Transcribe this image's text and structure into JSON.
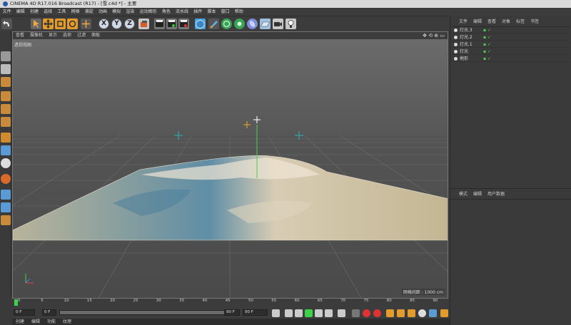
{
  "window": {
    "title": "CINEMA 4D R17.016 Broadcast (R17) - [雪.c4d *] - 主要"
  },
  "menu": [
    "文件",
    "编辑",
    "创建",
    "选择",
    "工具",
    "网格",
    "捕捉",
    "动画",
    "模拟",
    "渲染",
    "运动图形",
    "角色",
    "流水线",
    "插件",
    "脚本",
    "窗口",
    "帮助"
  ],
  "toolbar": {
    "axis_x": "X",
    "axis_y": "Y",
    "axis_z": "Z"
  },
  "viewport": {
    "menu": [
      "查看",
      "摄像机",
      "显示",
      "选项",
      "过滤",
      "面板"
    ],
    "label": "透视视图",
    "grid_info": "网格间距 : 1000 cm"
  },
  "objects_panel": {
    "tabs": [
      "文件",
      "编辑",
      "查看",
      "对象",
      "标签",
      "书签"
    ],
    "items": [
      {
        "name": "灯光.3"
      },
      {
        "name": "灯光.2"
      },
      {
        "name": "灯光.1"
      },
      {
        "name": "灯光"
      },
      {
        "name": "地形"
      }
    ]
  },
  "attributes_panel": {
    "tabs": [
      "模式",
      "编辑",
      "用户数据"
    ]
  },
  "timeline": {
    "ticks": [
      "0",
      "5",
      "10",
      "15",
      "20",
      "25",
      "30",
      "35",
      "40",
      "45",
      "50",
      "55",
      "60",
      "65",
      "70",
      "75",
      "80",
      "85",
      "90"
    ]
  },
  "transport": {
    "current_frame": "0 F",
    "start_frame": "0 F",
    "end_frame": "90 F",
    "max_frame": "90 F"
  },
  "bottom_tabs": [
    "创建",
    "编辑",
    "功能",
    "纹理"
  ],
  "colors": {
    "accent": "#e39b2b",
    "viewport_bg": "#5a5a5a",
    "terrain": "#c9bca3",
    "terrain_blue": "#4f7f96"
  }
}
